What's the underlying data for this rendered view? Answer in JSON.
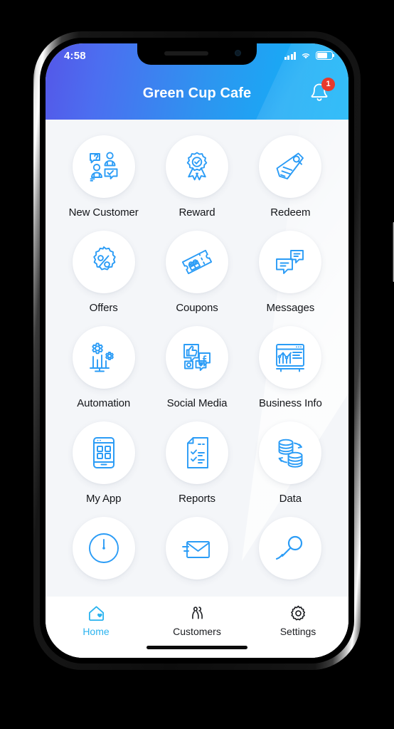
{
  "device": {
    "status_bar": {
      "time": "4:58",
      "signal_icon": "signal-bars-icon",
      "wifi_icon": "wifi-icon",
      "battery_icon": "battery-charging-icon"
    },
    "home_indicator": "home-indicator"
  },
  "header": {
    "title": "Green Cup Cafe",
    "notification_icon": "bell-icon",
    "notification_count": "1",
    "gradient_start": "#5457e8",
    "gradient_end": "#0db2f7",
    "badge_color": "#e8392b"
  },
  "theme": {
    "page_background": "#f4f6f9",
    "icon_blue": "#2b9cf6",
    "active_tab_color": "#2bb3ef",
    "text_color": "#14161a"
  },
  "grid": {
    "items": [
      {
        "label": "New Customer",
        "icon": "customer-support-people-icon"
      },
      {
        "label": "Reward",
        "icon": "award-ribbon-icon"
      },
      {
        "label": "Redeem",
        "icon": "price-tag-icon"
      },
      {
        "label": "Offers",
        "icon": "percent-badge-icon"
      },
      {
        "label": "Coupons",
        "icon": "coupon-ticket-gift-icon"
      },
      {
        "label": "Messages",
        "icon": "chat-bubbles-icon"
      },
      {
        "label": "Automation",
        "icon": "gears-chart-icon"
      },
      {
        "label": "Social Media",
        "icon": "social-media-bubbles-icon"
      },
      {
        "label": "Business Info",
        "icon": "browser-analytics-icon"
      },
      {
        "label": "My App",
        "icon": "smartphone-apps-icon"
      },
      {
        "label": "Reports",
        "icon": "checklist-document-icon"
      },
      {
        "label": "Data",
        "icon": "database-sync-icon"
      },
      {
        "label": "",
        "icon": "clock-dial-icon"
      },
      {
        "label": "",
        "icon": "envelope-mail-icon"
      },
      {
        "label": "",
        "icon": "search-magnifier-icon"
      }
    ]
  },
  "tabbar": {
    "tabs": [
      {
        "label": "Home",
        "icon": "home-heart-icon",
        "active": true
      },
      {
        "label": "Customers",
        "icon": "people-icon",
        "active": false
      },
      {
        "label": "Settings",
        "icon": "gear-icon",
        "active": false
      }
    ]
  }
}
